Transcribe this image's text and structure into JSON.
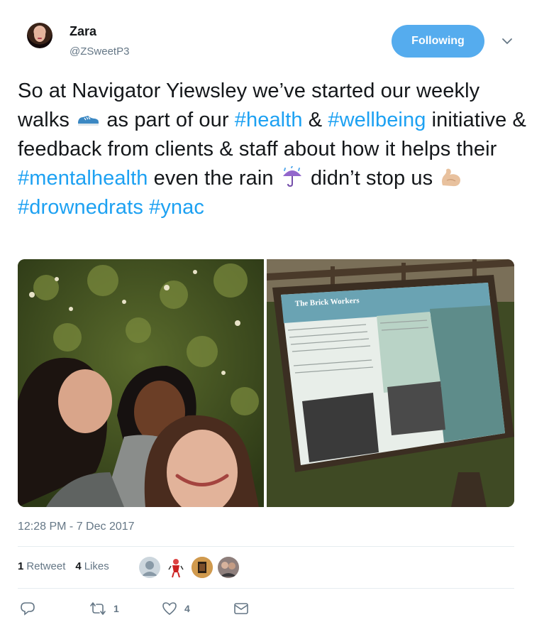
{
  "author": {
    "display_name": "Zara",
    "handle": "@ZSweetP3",
    "avatar_icon": "profile-photo-icon"
  },
  "follow_button": {
    "label": "Following",
    "color": "#55acee"
  },
  "menu_caret_icon": "chevron-down-icon",
  "tweet": {
    "segments": [
      {
        "text": "So at Navigator Yiewsley we’ve started our weekly walks ",
        "type": "text"
      },
      {
        "emoji": "running-shoe-icon"
      },
      {
        "text": " as part of our ",
        "type": "text"
      },
      {
        "text": "#health",
        "type": "hashtag"
      },
      {
        "text": " & ",
        "type": "text"
      },
      {
        "text": "#wellbeing",
        "type": "hashtag"
      },
      {
        "text": " initiative & feedback from clients & staff about how it helps their ",
        "type": "text"
      },
      {
        "text": "#mentalhealth",
        "type": "hashtag"
      },
      {
        "text": " even the rain ",
        "type": "text"
      },
      {
        "emoji": "umbrella-rain-icon"
      },
      {
        "text": " didn’t stop us ",
        "type": "text"
      },
      {
        "emoji": "flexed-biceps-icon"
      },
      {
        "text": " ",
        "type": "text"
      },
      {
        "text": "#drownedrats",
        "type": "hashtag"
      },
      {
        "text": " ",
        "type": "text"
      },
      {
        "text": "#ynac",
        "type": "hashtag"
      }
    ],
    "hashtag_color": "#1da1f2"
  },
  "media": {
    "photos": [
      {
        "name": "selfie-photo"
      },
      {
        "name": "brick-workers-sign-photo"
      }
    ]
  },
  "timestamp": "12:28 PM - 7 Dec 2017",
  "stats": {
    "retweets_count": "1",
    "retweets_label": "Retweet",
    "likes_count": "4",
    "likes_label": "Likes"
  },
  "actions": {
    "reply_icon": "reply-icon",
    "retweet_icon": "retweet-icon",
    "retweet_count": "1",
    "like_icon": "heart-icon",
    "like_count": "4",
    "dm_icon": "envelope-icon"
  }
}
